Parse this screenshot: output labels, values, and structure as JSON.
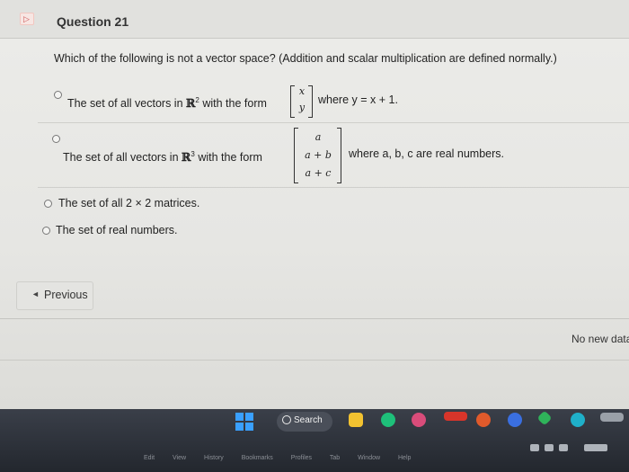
{
  "question": {
    "title": "Question 21",
    "prompt": "Which of the following is not a vector space? (Addition and scalar multiplication are defined normally.)"
  },
  "options": [
    {
      "text_before": "The set of all vectors in",
      "space": "ℝ",
      "power": "2",
      "text_mid": "with the form",
      "vector": [
        "x",
        "y"
      ],
      "text_after": "where y = x + 1."
    },
    {
      "text_before": "The set of all vectors in",
      "space": "ℝ",
      "power": "3",
      "text_mid": "with the form",
      "vector": [
        "a",
        "a + b",
        "a + c"
      ],
      "text_after": "where a, b, c are real numbers."
    },
    {
      "text": "The set of all 2 × 2 matrices."
    },
    {
      "text": "The set of real numbers."
    }
  ],
  "nav": {
    "previous_label": "Previous"
  },
  "status": {
    "no_new_data": "No new data"
  },
  "taskbar": {
    "search_label": "Search",
    "menu": [
      "Edit",
      "View",
      "History",
      "Bookmarks",
      "Profiles",
      "Tab",
      "Window",
      "Help"
    ]
  },
  "colors": {
    "windows_blue": "#3aa0ff",
    "flag_border": "#f2c6c0",
    "taskbar": "#2a2e36"
  }
}
